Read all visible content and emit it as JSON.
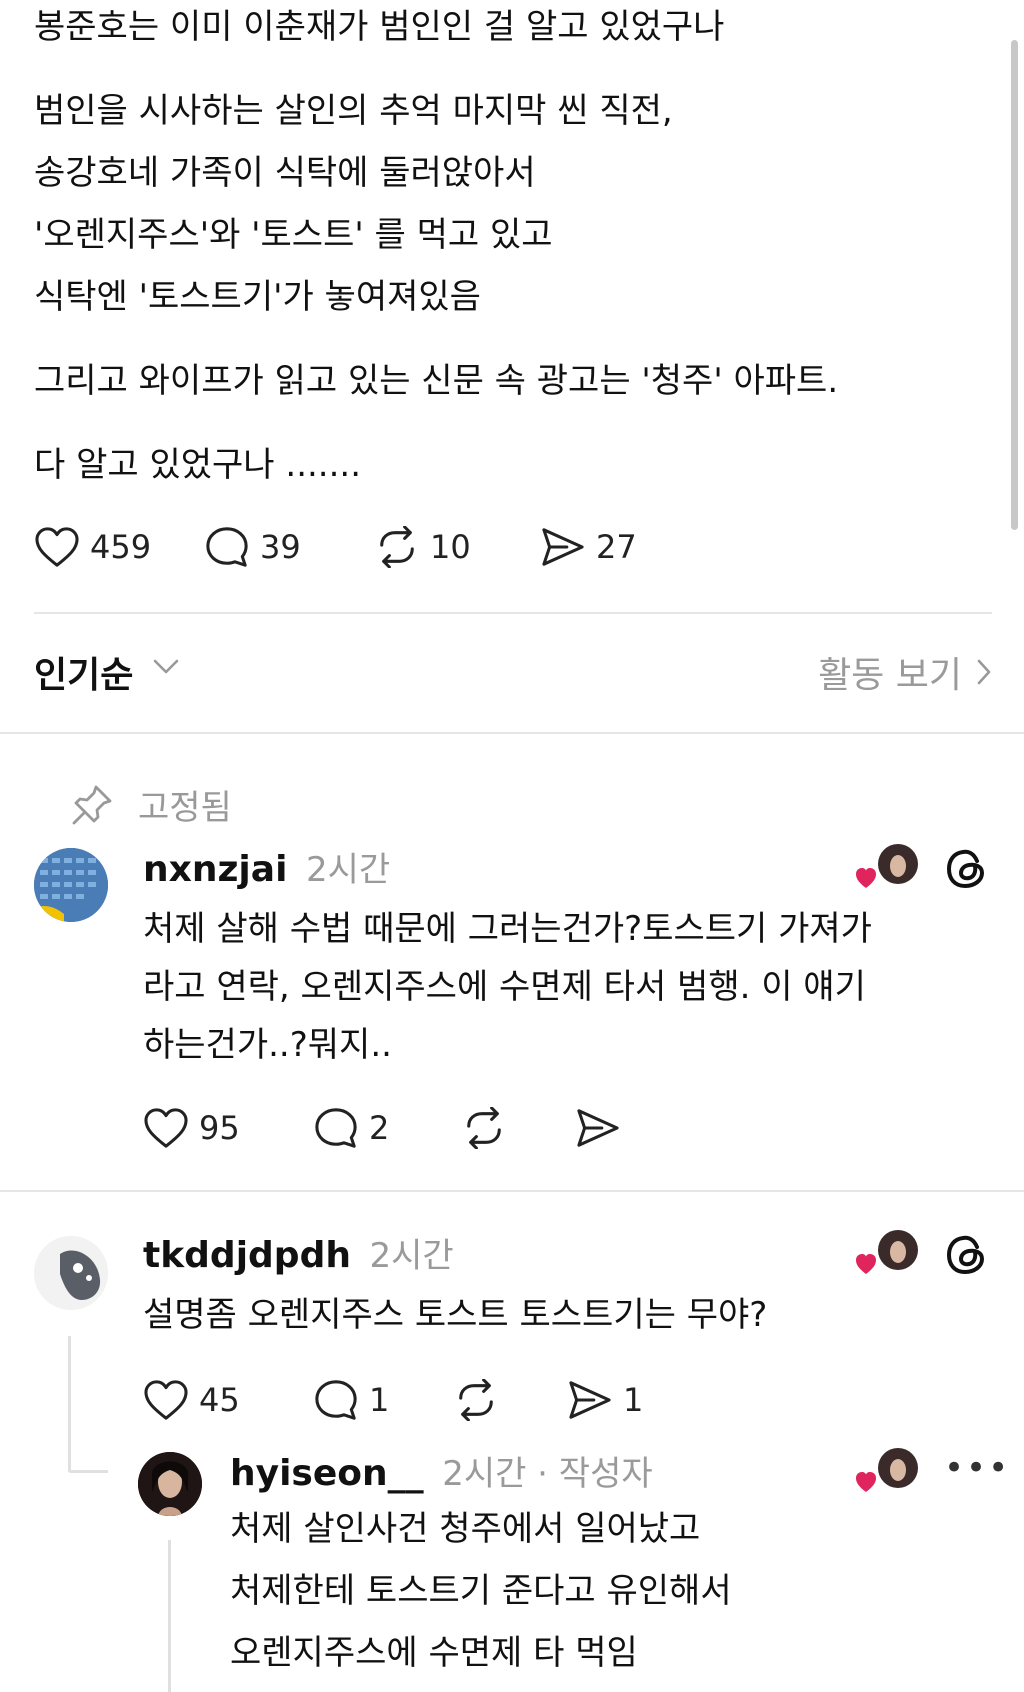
{
  "post": {
    "line1": "봉준호는 이미 이춘재가 범인인 걸 알고 있었구나",
    "para2": [
      "범인을 시사하는 살인의 추억 마지막 씬 직전,",
      "송강호네 가족이 식탁에 둘러앉아서",
      "'오렌지주스'와 '토스트' 를 먹고 있고",
      "식탁엔 '토스트기'가 놓여져있음"
    ],
    "para3": "그리고 와이프가 읽고 있는 신문 속 광고는 '청주' 아파트.",
    "para4": "다 알고 있었구나 .......",
    "likes": "459",
    "comments": "39",
    "reposts": "10",
    "shares": "27"
  },
  "sort": {
    "label": "인기순",
    "activity_label": "활동 보기"
  },
  "pinned_label": "고정됨",
  "comments": [
    {
      "username": "nxnzjai",
      "time": "2시간",
      "lines": [
        "처제 살해 수법 때문에 그러는건가?토스트기 가져가",
        "라고 연락, 오렌지주스에 수면제 타서 범행. 이 얘기",
        "하는건가..?뭐지.."
      ],
      "likes": "95",
      "replies": "2"
    },
    {
      "username": "tkddjdpdh",
      "time": "2시간",
      "lines": [
        "설명좀 오렌지주스 토스트 토스트기는 무야?"
      ],
      "likes": "45",
      "replies": "1",
      "shares": "1"
    },
    {
      "username": "hyiseon__",
      "time": "2시간 · 작성자",
      "lines": [
        "처제 살인사건 청주에서 일어났고",
        "처제한테 토스트기 준다고 유인해서",
        "오렌지주스에 수면제 타 먹임"
      ]
    }
  ],
  "icons": {
    "heart": "heart-icon",
    "comment": "comment-bubble-icon",
    "repost": "repost-icon",
    "share": "share-send-icon",
    "pin": "pin-icon",
    "threads": "threads-logo-icon",
    "more": "more-dots-icon"
  },
  "colors": {
    "text": "#111111",
    "muted": "#9a9a9a",
    "divider": "#e6e6e6",
    "heart_red": "#e0245e"
  }
}
